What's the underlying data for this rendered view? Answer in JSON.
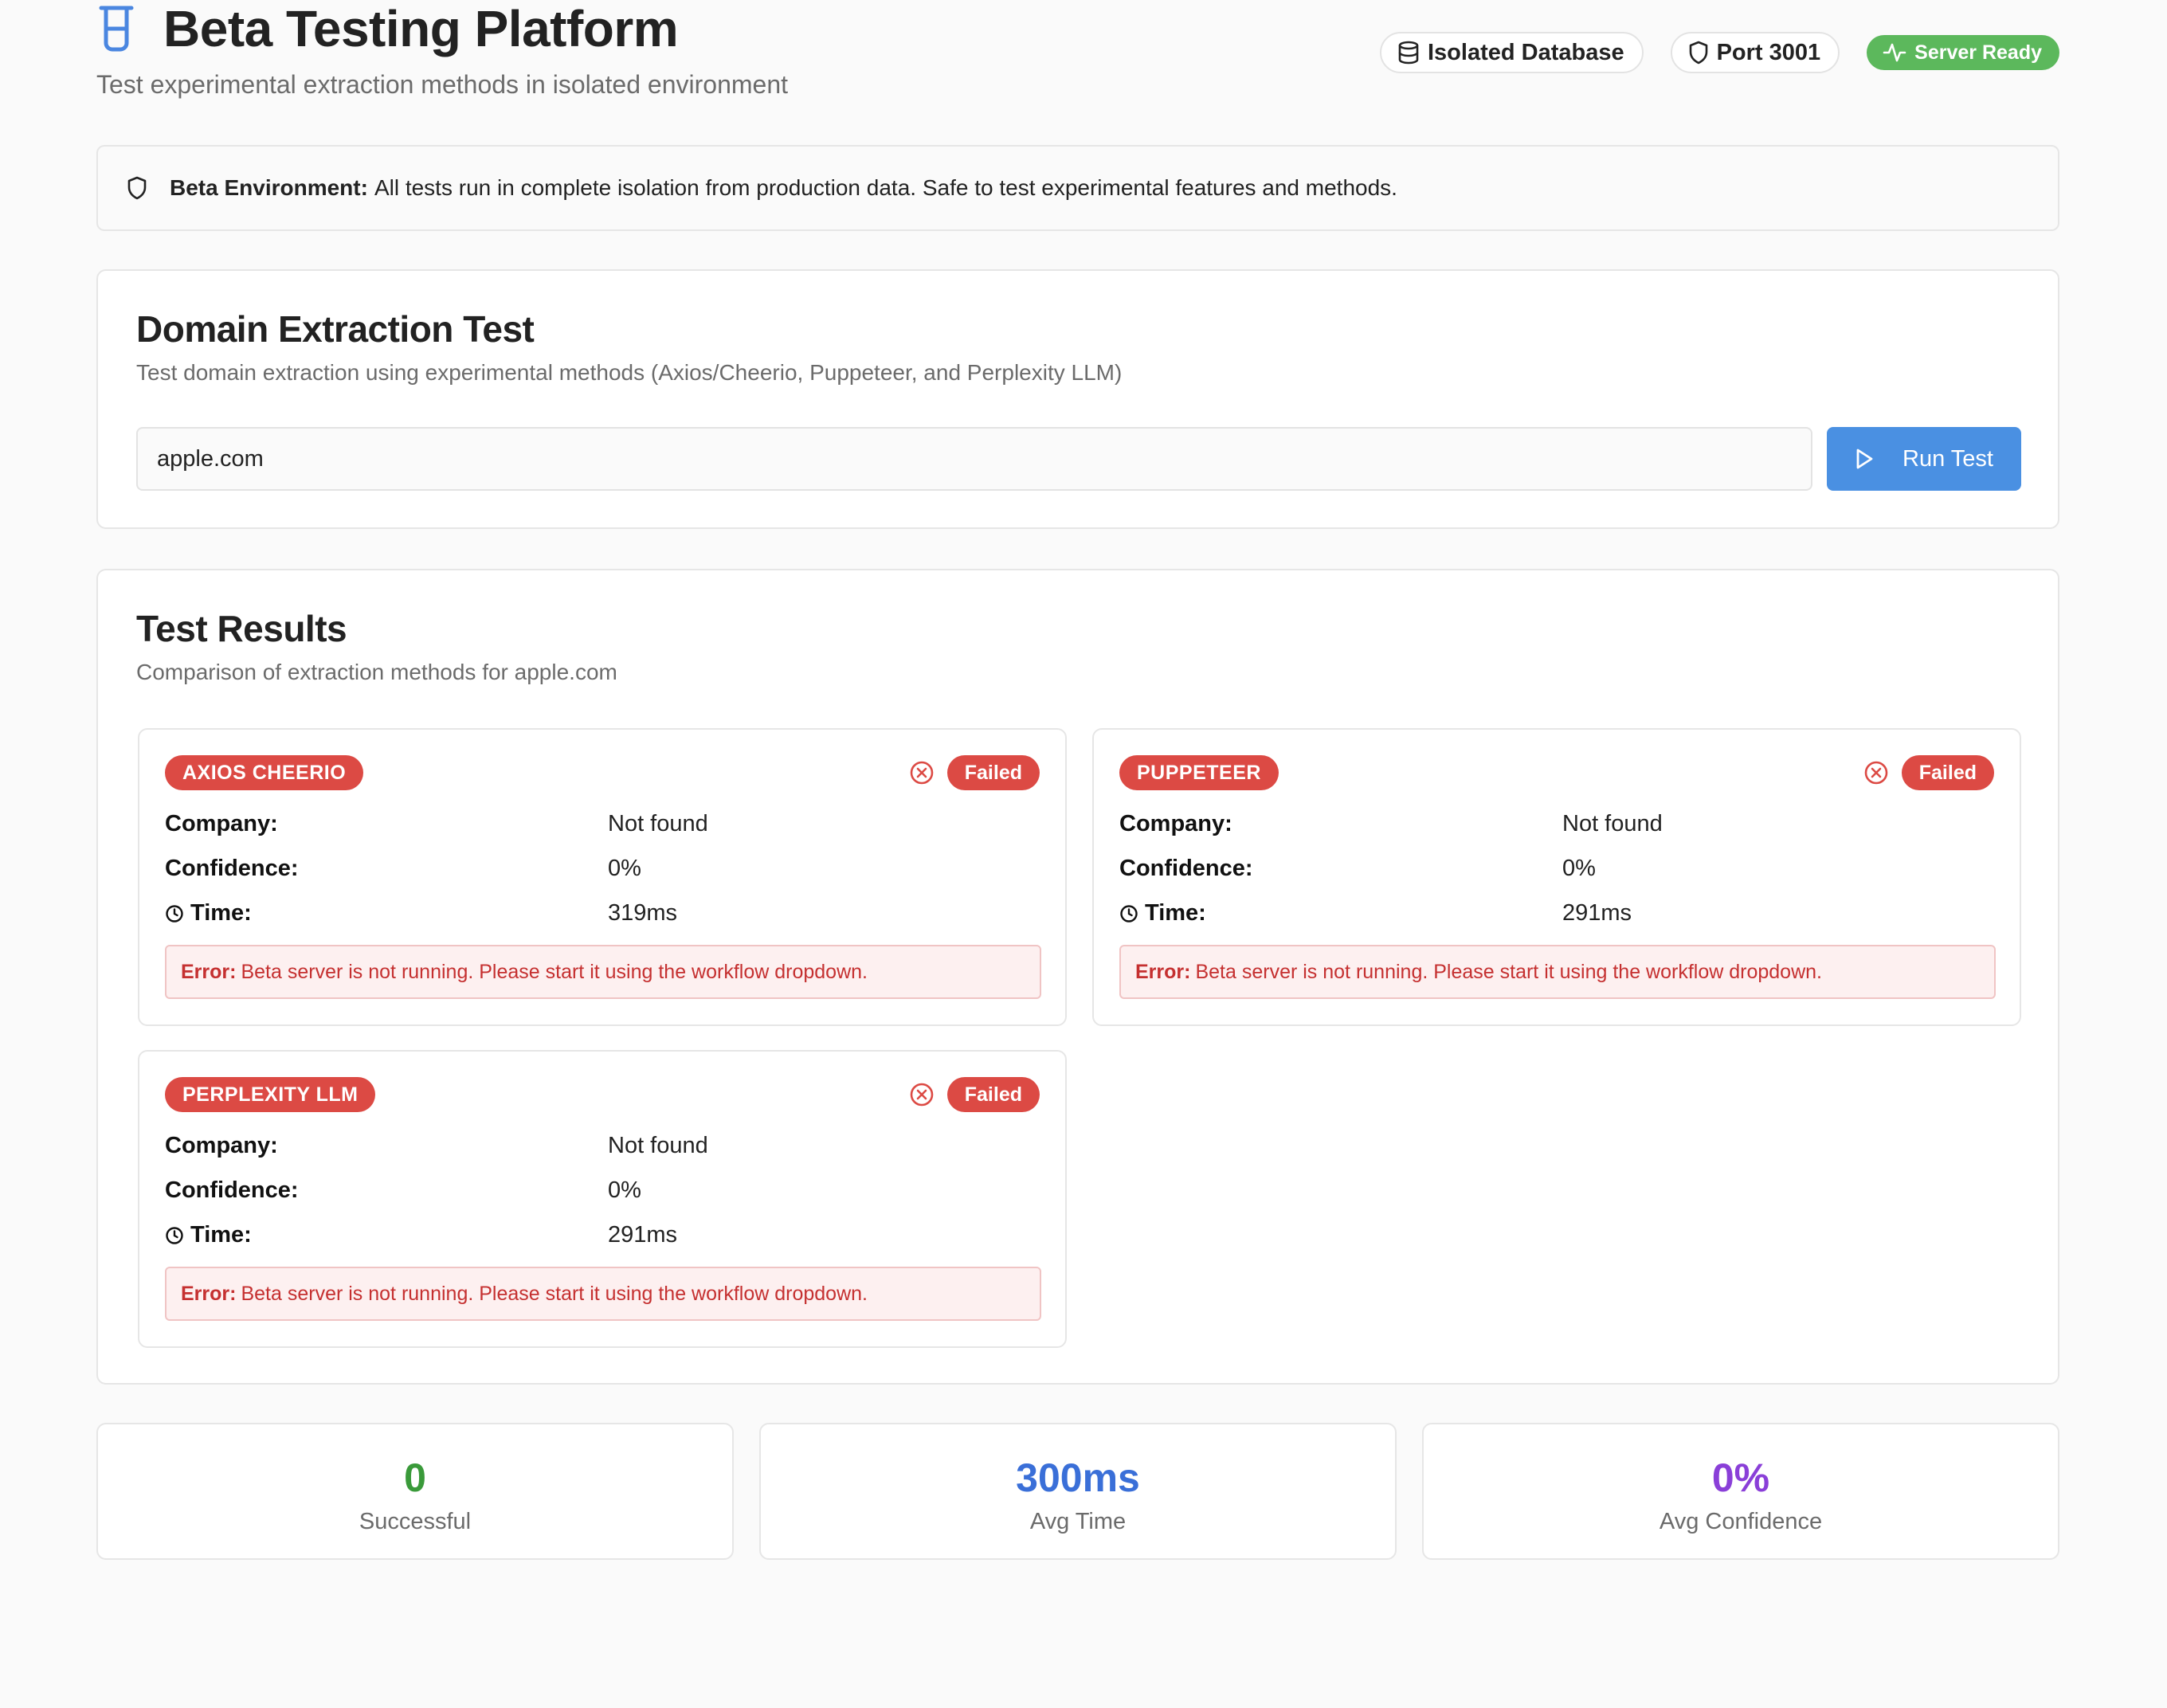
{
  "header": {
    "title": "Beta Testing Platform",
    "subtitle": "Test experimental extraction methods in isolated environment",
    "badges": {
      "database": "Isolated Database",
      "port": "Port 3001",
      "server": "Server Ready"
    }
  },
  "alert": {
    "label": "Beta Environment:",
    "text": "All tests run in complete isolation from production data. Safe to test experimental features and methods."
  },
  "domain_test": {
    "title": "Domain Extraction Test",
    "description": "Test domain extraction using experimental methods (Axios/Cheerio, Puppeteer, and Perplexity LLM)",
    "input_value": "apple.com",
    "run_label": "Run Test"
  },
  "results": {
    "title": "Test Results",
    "description": "Comparison of extraction methods for apple.com",
    "labels": {
      "company": "Company:",
      "confidence": "Confidence:",
      "time": "Time:",
      "error": "Error:"
    },
    "methods": [
      {
        "name": "AXIOS CHEERIO",
        "status": "Failed",
        "company": "Not found",
        "confidence": "0%",
        "time": "319ms",
        "error": "Beta server is not running. Please start it using the workflow dropdown."
      },
      {
        "name": "PUPPETEER",
        "status": "Failed",
        "company": "Not found",
        "confidence": "0%",
        "time": "291ms",
        "error": "Beta server is not running. Please start it using the workflow dropdown."
      },
      {
        "name": "PERPLEXITY LLM",
        "status": "Failed",
        "company": "Not found",
        "confidence": "0%",
        "time": "291ms",
        "error": "Beta server is not running. Please start it using the workflow dropdown."
      }
    ]
  },
  "stats": [
    {
      "value": "0",
      "label": "Successful",
      "color": "#3a9a3a"
    },
    {
      "value": "300ms",
      "label": "Avg Time",
      "color": "#3a6fd8"
    },
    {
      "value": "0%",
      "label": "Avg Confidence",
      "color": "#8a3fd8"
    }
  ],
  "colors": {
    "accent_blue": "#4a90e2",
    "failed_red": "#dc4a44",
    "ready_green": "#5cb85c"
  }
}
